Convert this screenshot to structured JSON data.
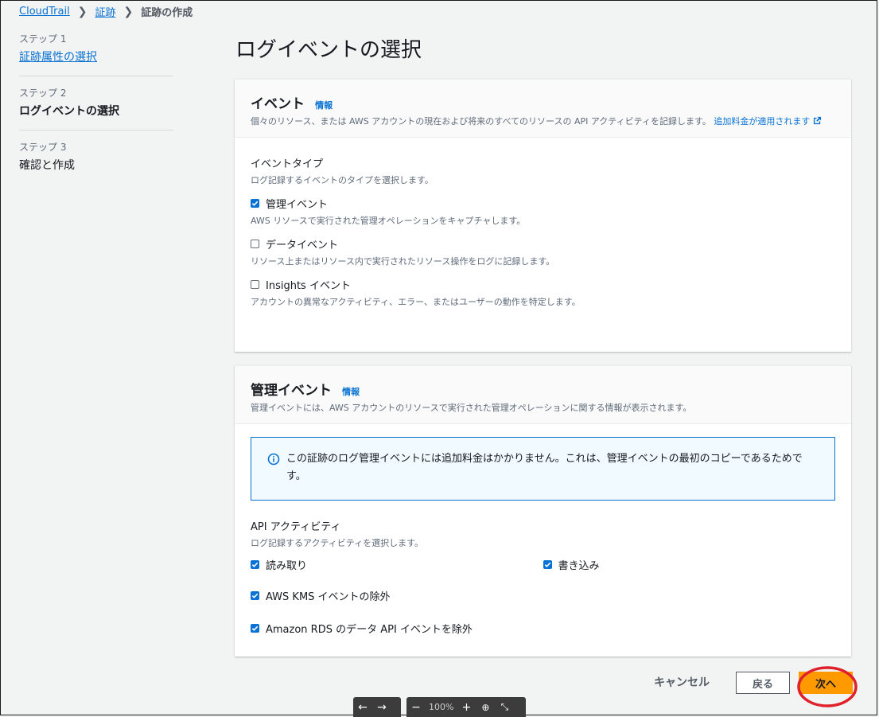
{
  "breadcrumb": {
    "root": "CloudTrail",
    "parent": "証跡",
    "current": "証跡の作成"
  },
  "steps": [
    {
      "num": "ステップ 1",
      "name": "証跡属性の選択"
    },
    {
      "num": "ステップ 2",
      "name": "ログイベントの選択"
    },
    {
      "num": "ステップ 3",
      "name": "確認と作成"
    }
  ],
  "page_title": "ログイベントの選択",
  "events_panel": {
    "title": "イベント",
    "info": "情報",
    "desc": "個々のリソース、または AWS アカウントの現在および将来のすべてのリソースの API アクティビティを記録します。",
    "desc_link": "追加料金が適用されます",
    "event_type_label": "イベントタイプ",
    "event_type_sub": "ログ記録するイベントのタイプを選択します。",
    "options": [
      {
        "label": "管理イベント",
        "desc": "AWS リソースで実行された管理オペレーションをキャプチャします。",
        "checked": true
      },
      {
        "label": "データイベント",
        "desc": "リソース上またはリソース内で実行されたリソース操作をログに記録します。",
        "checked": false
      },
      {
        "label": "Insights イベント",
        "desc": "アカウントの異常なアクティビティ、エラー、またはユーザーの動作を特定します。",
        "checked": false
      }
    ]
  },
  "mgmt_panel": {
    "title": "管理イベント",
    "info": "情報",
    "desc": "管理イベントには、AWS アカウントのリソースで実行された管理オペレーションに関する情報が表示されます。",
    "alert": "この証跡のログ管理イベントには追加料金はかかりません。これは、管理イベントの最初のコピーであるためです。",
    "api_label": "API アクティビティ",
    "api_sub": "ログ記録するアクティビティを選択します。",
    "read": "読み取り",
    "write": "書き込み",
    "kms": "AWS KMS イベントの除外",
    "rds": "Amazon RDS のデータ API イベントを除外"
  },
  "footer": {
    "cancel": "キャンセル",
    "back": "戻る",
    "next": "次へ"
  },
  "viewer": {
    "zoom": "100%"
  }
}
